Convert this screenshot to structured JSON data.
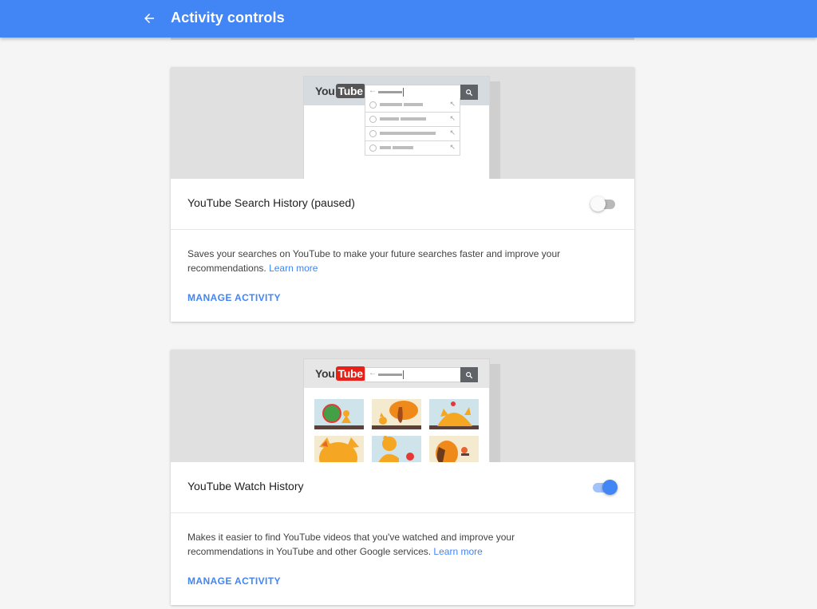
{
  "header": {
    "title": "Activity controls",
    "back_icon": "arrow-back-icon",
    "background": "#4285f4"
  },
  "cards": [
    {
      "logo": {
        "you": "You",
        "tube": "Tube"
      },
      "label": "YouTube Search History (paused)",
      "enabled": false,
      "description": "Saves your searches on YouTube to make your future searches faster and improve your recommendations.",
      "learn_more": "Learn more",
      "manage": "MANAGE ACTIVITY"
    },
    {
      "logo": {
        "you": "You",
        "tube": "Tube"
      },
      "label": "YouTube Watch History",
      "enabled": true,
      "description": "Makes it easier to find YouTube videos that you've watched and improve your recommendations in YouTube and other Google services.",
      "learn_more": "Learn more",
      "manage": "MANAGE ACTIVITY"
    }
  ],
  "colors": {
    "accent": "#4285f4",
    "youtube_red": "#e62117",
    "toggle_off_track": "#b9b9b9",
    "toggle_on_track": "#a1c2fa"
  }
}
